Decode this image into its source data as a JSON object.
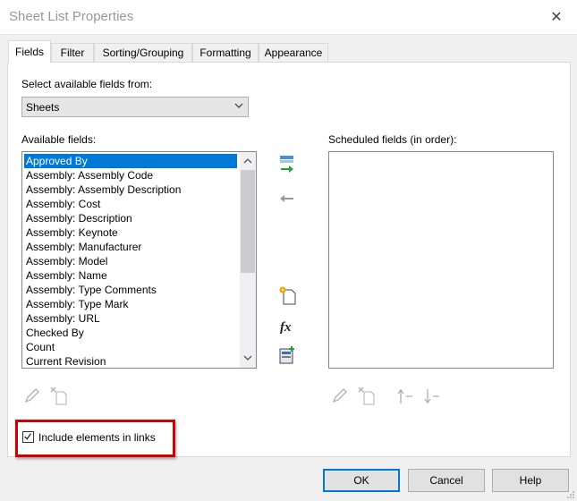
{
  "window": {
    "title": "Sheet List Properties",
    "close_glyph": "✕"
  },
  "tabs": [
    {
      "label": "Fields",
      "active": true
    },
    {
      "label": "Filter"
    },
    {
      "label": "Sorting/Grouping"
    },
    {
      "label": "Formatting"
    },
    {
      "label": "Appearance"
    }
  ],
  "fields_tab": {
    "select_from_label": "Select available fields from:",
    "select_from_value": "Sheets",
    "available_label": "Available fields:",
    "scheduled_label": "Scheduled fields (in order):",
    "available_fields": [
      "Approved By",
      "Assembly: Assembly Code",
      "Assembly: Assembly Description",
      "Assembly: Cost",
      "Assembly: Description",
      "Assembly: Keynote",
      "Assembly: Manufacturer",
      "Assembly: Model",
      "Assembly: Name",
      "Assembly: Type Comments",
      "Assembly: Type Mark",
      "Assembly: URL",
      "Checked By",
      "Count",
      "Current Revision"
    ],
    "selected_field": "Approved By",
    "scheduled_fields": [],
    "include_links_label": "Include elements in links",
    "include_links_checked": true
  },
  "buttons": {
    "ok": "OK",
    "cancel": "Cancel",
    "help": "Help"
  },
  "colors": {
    "selection": "#0078d7",
    "highlight_box": "#d20000",
    "add_arrow": "#2a9d3a"
  }
}
